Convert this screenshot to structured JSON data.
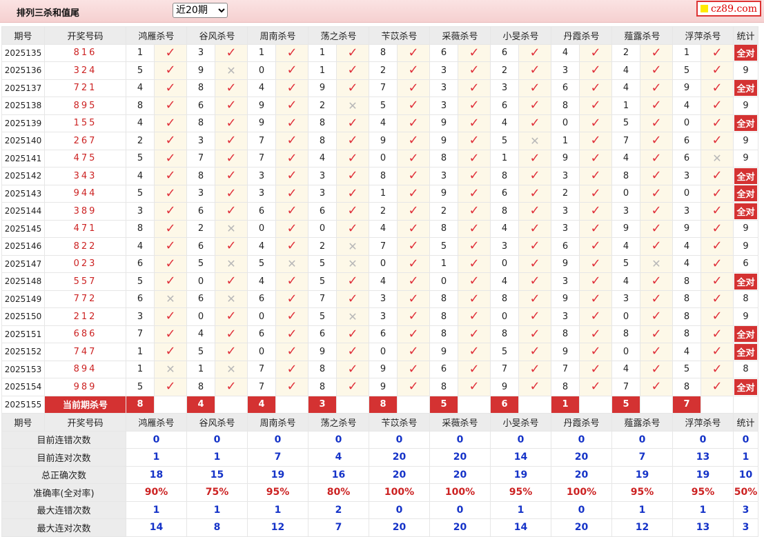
{
  "header": {
    "title": "排列三杀和值尾",
    "period_selected": "近20期",
    "period_options": [
      "近20期"
    ],
    "logo_text": "cz89.com",
    "logo_color": "#dd0000"
  },
  "columns": [
    "期号",
    "开奖号码",
    "鸿雁杀号",
    "谷风杀号",
    "周南杀号",
    "荡之杀号",
    "苄苡杀号",
    "采薇杀号",
    "小旻杀号",
    "丹霞杀号",
    "薤露杀号",
    "浮萍杀号",
    "统计"
  ],
  "rows": [
    {
      "issue": "2025135",
      "draw": "816",
      "picks": [
        [
          1,
          1
        ],
        [
          3,
          1
        ],
        [
          1,
          1
        ],
        [
          1,
          1
        ],
        [
          8,
          1
        ],
        [
          6,
          1
        ],
        [
          6,
          1
        ],
        [
          4,
          1
        ],
        [
          2,
          1
        ],
        [
          1,
          1
        ]
      ],
      "stat": "全对"
    },
    {
      "issue": "2025136",
      "draw": "324",
      "picks": [
        [
          5,
          1
        ],
        [
          9,
          0
        ],
        [
          0,
          1
        ],
        [
          1,
          1
        ],
        [
          2,
          1
        ],
        [
          3,
          1
        ],
        [
          2,
          1
        ],
        [
          3,
          1
        ],
        [
          4,
          1
        ],
        [
          5,
          1
        ]
      ],
      "stat": "9"
    },
    {
      "issue": "2025137",
      "draw": "721",
      "picks": [
        [
          4,
          1
        ],
        [
          8,
          1
        ],
        [
          4,
          1
        ],
        [
          9,
          1
        ],
        [
          7,
          1
        ],
        [
          3,
          1
        ],
        [
          3,
          1
        ],
        [
          6,
          1
        ],
        [
          4,
          1
        ],
        [
          9,
          1
        ]
      ],
      "stat": "全对"
    },
    {
      "issue": "2025138",
      "draw": "895",
      "picks": [
        [
          8,
          1
        ],
        [
          6,
          1
        ],
        [
          9,
          1
        ],
        [
          2,
          0
        ],
        [
          5,
          1
        ],
        [
          3,
          1
        ],
        [
          6,
          1
        ],
        [
          8,
          1
        ],
        [
          1,
          1
        ],
        [
          4,
          1
        ]
      ],
      "stat": "9"
    },
    {
      "issue": "2025139",
      "draw": "155",
      "picks": [
        [
          4,
          1
        ],
        [
          8,
          1
        ],
        [
          9,
          1
        ],
        [
          8,
          1
        ],
        [
          4,
          1
        ],
        [
          9,
          1
        ],
        [
          4,
          1
        ],
        [
          0,
          1
        ],
        [
          5,
          1
        ],
        [
          0,
          1
        ]
      ],
      "stat": "全对"
    },
    {
      "issue": "2025140",
      "draw": "267",
      "picks": [
        [
          2,
          1
        ],
        [
          3,
          1
        ],
        [
          7,
          1
        ],
        [
          8,
          1
        ],
        [
          9,
          1
        ],
        [
          9,
          1
        ],
        [
          5,
          0
        ],
        [
          1,
          1
        ],
        [
          7,
          1
        ],
        [
          6,
          1
        ]
      ],
      "stat": "9"
    },
    {
      "issue": "2025141",
      "draw": "475",
      "picks": [
        [
          5,
          1
        ],
        [
          7,
          1
        ],
        [
          7,
          1
        ],
        [
          4,
          1
        ],
        [
          0,
          1
        ],
        [
          8,
          1
        ],
        [
          1,
          1
        ],
        [
          9,
          1
        ],
        [
          4,
          1
        ],
        [
          6,
          0
        ]
      ],
      "stat": "9"
    },
    {
      "issue": "2025142",
      "draw": "343",
      "picks": [
        [
          4,
          1
        ],
        [
          8,
          1
        ],
        [
          3,
          1
        ],
        [
          3,
          1
        ],
        [
          8,
          1
        ],
        [
          3,
          1
        ],
        [
          8,
          1
        ],
        [
          3,
          1
        ],
        [
          8,
          1
        ],
        [
          3,
          1
        ]
      ],
      "stat": "全对"
    },
    {
      "issue": "2025143",
      "draw": "944",
      "picks": [
        [
          5,
          1
        ],
        [
          3,
          1
        ],
        [
          3,
          1
        ],
        [
          3,
          1
        ],
        [
          1,
          1
        ],
        [
          9,
          1
        ],
        [
          6,
          1
        ],
        [
          2,
          1
        ],
        [
          0,
          1
        ],
        [
          0,
          1
        ]
      ],
      "stat": "全对"
    },
    {
      "issue": "2025144",
      "draw": "389",
      "picks": [
        [
          3,
          1
        ],
        [
          6,
          1
        ],
        [
          6,
          1
        ],
        [
          6,
          1
        ],
        [
          2,
          1
        ],
        [
          2,
          1
        ],
        [
          8,
          1
        ],
        [
          3,
          1
        ],
        [
          3,
          1
        ],
        [
          3,
          1
        ]
      ],
      "stat": "全对"
    },
    {
      "issue": "2025145",
      "draw": "471",
      "picks": [
        [
          8,
          1
        ],
        [
          2,
          0
        ],
        [
          0,
          1
        ],
        [
          0,
          1
        ],
        [
          4,
          1
        ],
        [
          8,
          1
        ],
        [
          4,
          1
        ],
        [
          3,
          1
        ],
        [
          9,
          1
        ],
        [
          9,
          1
        ]
      ],
      "stat": "9"
    },
    {
      "issue": "2025146",
      "draw": "822",
      "picks": [
        [
          4,
          1
        ],
        [
          6,
          1
        ],
        [
          4,
          1
        ],
        [
          2,
          0
        ],
        [
          7,
          1
        ],
        [
          5,
          1
        ],
        [
          3,
          1
        ],
        [
          6,
          1
        ],
        [
          4,
          1
        ],
        [
          4,
          1
        ]
      ],
      "stat": "9"
    },
    {
      "issue": "2025147",
      "draw": "023",
      "picks": [
        [
          6,
          1
        ],
        [
          5,
          0
        ],
        [
          5,
          0
        ],
        [
          5,
          0
        ],
        [
          0,
          1
        ],
        [
          1,
          1
        ],
        [
          0,
          1
        ],
        [
          9,
          1
        ],
        [
          5,
          0
        ],
        [
          4,
          1
        ]
      ],
      "stat": "6"
    },
    {
      "issue": "2025148",
      "draw": "557",
      "picks": [
        [
          5,
          1
        ],
        [
          0,
          1
        ],
        [
          4,
          1
        ],
        [
          5,
          1
        ],
        [
          4,
          1
        ],
        [
          0,
          1
        ],
        [
          4,
          1
        ],
        [
          3,
          1
        ],
        [
          4,
          1
        ],
        [
          8,
          1
        ]
      ],
      "stat": "全对"
    },
    {
      "issue": "2025149",
      "draw": "772",
      "picks": [
        [
          6,
          0
        ],
        [
          6,
          0
        ],
        [
          6,
          1
        ],
        [
          7,
          1
        ],
        [
          3,
          1
        ],
        [
          8,
          1
        ],
        [
          8,
          1
        ],
        [
          9,
          1
        ],
        [
          3,
          1
        ],
        [
          8,
          1
        ]
      ],
      "stat": "8"
    },
    {
      "issue": "2025150",
      "draw": "212",
      "picks": [
        [
          3,
          1
        ],
        [
          0,
          1
        ],
        [
          0,
          1
        ],
        [
          5,
          0
        ],
        [
          3,
          1
        ],
        [
          8,
          1
        ],
        [
          0,
          1
        ],
        [
          3,
          1
        ],
        [
          0,
          1
        ],
        [
          8,
          1
        ]
      ],
      "stat": "9"
    },
    {
      "issue": "2025151",
      "draw": "686",
      "picks": [
        [
          7,
          1
        ],
        [
          4,
          1
        ],
        [
          6,
          1
        ],
        [
          6,
          1
        ],
        [
          6,
          1
        ],
        [
          8,
          1
        ],
        [
          8,
          1
        ],
        [
          8,
          1
        ],
        [
          8,
          1
        ],
        [
          8,
          1
        ]
      ],
      "stat": "全对"
    },
    {
      "issue": "2025152",
      "draw": "747",
      "picks": [
        [
          1,
          1
        ],
        [
          5,
          1
        ],
        [
          0,
          1
        ],
        [
          9,
          1
        ],
        [
          0,
          1
        ],
        [
          9,
          1
        ],
        [
          5,
          1
        ],
        [
          9,
          1
        ],
        [
          0,
          1
        ],
        [
          4,
          1
        ]
      ],
      "stat": "全对"
    },
    {
      "issue": "2025153",
      "draw": "894",
      "picks": [
        [
          1,
          0
        ],
        [
          1,
          0
        ],
        [
          7,
          1
        ],
        [
          8,
          1
        ],
        [
          9,
          1
        ],
        [
          6,
          1
        ],
        [
          7,
          1
        ],
        [
          7,
          1
        ],
        [
          4,
          1
        ],
        [
          5,
          1
        ]
      ],
      "stat": "8"
    },
    {
      "issue": "2025154",
      "draw": "989",
      "picks": [
        [
          5,
          1
        ],
        [
          8,
          1
        ],
        [
          7,
          1
        ],
        [
          8,
          1
        ],
        [
          9,
          1
        ],
        [
          8,
          1
        ],
        [
          9,
          1
        ],
        [
          8,
          1
        ],
        [
          7,
          1
        ],
        [
          8,
          1
        ]
      ],
      "stat": "全对"
    }
  ],
  "current": {
    "issue": "2025155",
    "label": "当前期杀号",
    "kills": [
      "8",
      "4",
      "4",
      "3",
      "8",
      "5",
      "6",
      "1",
      "5",
      "7"
    ]
  },
  "stats": [
    {
      "label": "目前连错次数",
      "values": [
        "0",
        "0",
        "0",
        "0",
        "0",
        "0",
        "0",
        "0",
        "0",
        "0",
        "0"
      ],
      "style": "blue"
    },
    {
      "label": "目前连对次数",
      "values": [
        "1",
        "1",
        "7",
        "4",
        "20",
        "20",
        "14",
        "20",
        "7",
        "13",
        "1"
      ],
      "style": "blue"
    },
    {
      "label": "总正确次数",
      "values": [
        "18",
        "15",
        "19",
        "16",
        "20",
        "20",
        "19",
        "20",
        "19",
        "19",
        "10"
      ],
      "style": "blue"
    },
    {
      "label": "准确率(全对率)",
      "values": [
        "90%",
        "75%",
        "95%",
        "80%",
        "100%",
        "100%",
        "95%",
        "100%",
        "95%",
        "95%",
        "50%"
      ],
      "style": "red"
    },
    {
      "label": "最大连错次数",
      "values": [
        "1",
        "1",
        "1",
        "2",
        "0",
        "0",
        "1",
        "0",
        "1",
        "1",
        "3"
      ],
      "style": "blue"
    },
    {
      "label": "最大连对次数",
      "values": [
        "14",
        "8",
        "12",
        "7",
        "20",
        "20",
        "14",
        "20",
        "12",
        "13",
        "3"
      ],
      "style": "blue"
    }
  ],
  "symbols": {
    "correct": "✓",
    "wrong": "✕"
  },
  "colors": {
    "accent": "#d43232",
    "tick": "#e0303a",
    "stat_blue": "#1533c8",
    "stat_red": "#cc2222",
    "header_bg": "#f5d0d0"
  }
}
